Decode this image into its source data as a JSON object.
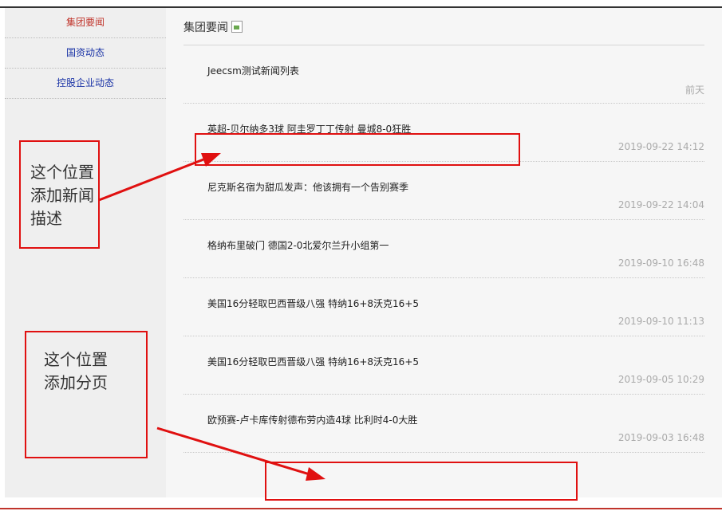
{
  "sidebar": {
    "items": [
      {
        "label": "集团要闻",
        "active": true
      },
      {
        "label": "国资动态",
        "active": false
      },
      {
        "label": "控股企业动态",
        "active": false
      }
    ]
  },
  "main": {
    "heading": "集团要闻",
    "news": [
      {
        "title": "Jeecsm测试新闻列表",
        "date": "前天"
      },
      {
        "title": "英超-贝尔纳多3球 阿圭罗丁丁传射 曼城8-0狂胜",
        "date": "2019-09-22 14:12"
      },
      {
        "title": "尼克斯名宿为甜瓜发声：他该拥有一个告别赛季",
        "date": "2019-09-22 14:04"
      },
      {
        "title": "格纳布里破门 德国2-0北爱尔兰升小组第一",
        "date": "2019-09-10 16:48"
      },
      {
        "title": "美国16分轻取巴西晋级八强 特纳16+8沃克16+5",
        "date": "2019-09-10 11:13"
      },
      {
        "title": "美国16分轻取巴西晋级八强 特纳16+8沃克16+5",
        "date": "2019-09-05 10:29"
      },
      {
        "title": "欧预赛-卢卡库传射德布劳内造4球 比利时4-0大胜",
        "date": "2019-09-03 16:48"
      }
    ]
  },
  "annotations": {
    "desc_line1": "这个位置",
    "desc_line2": "添加新闻",
    "desc_line3": "描述",
    "page_line1": "这个位置",
    "page_line2": "添加分页"
  },
  "colors": {
    "annotation": "#e01010",
    "active_link": "#c0342b",
    "link": "#1a33a6"
  }
}
